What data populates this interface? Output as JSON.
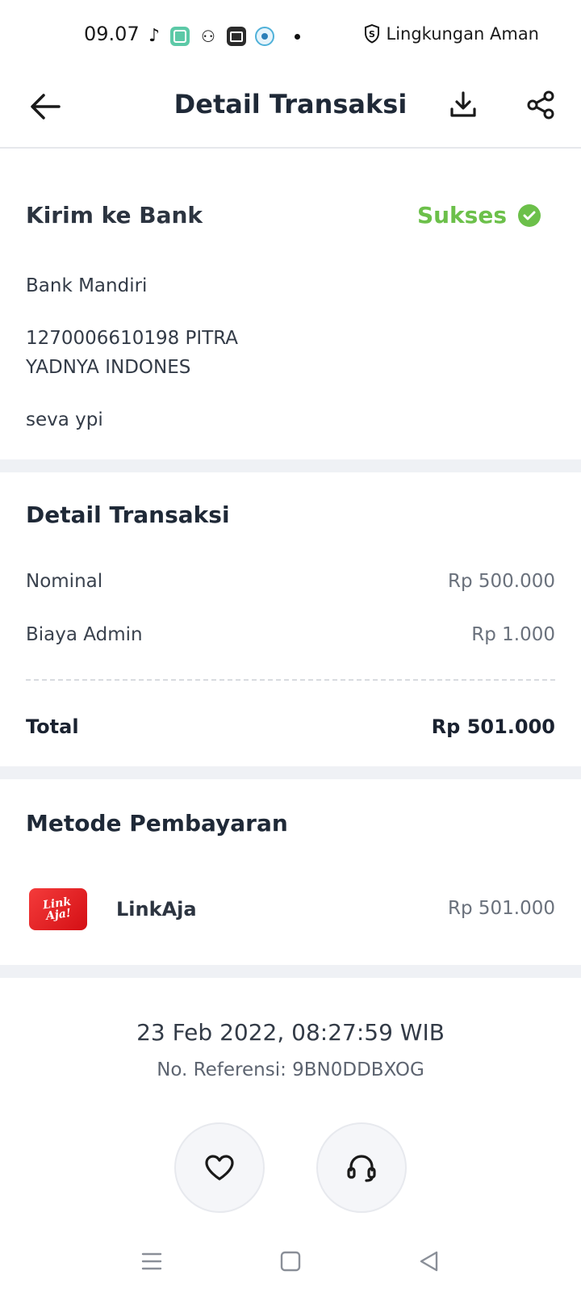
{
  "status_bar": {
    "time": "09.07",
    "notification_icons": [
      "music-note-icon",
      "teal-app-icon",
      "owl-icon",
      "dark-app-icon",
      "blue-app-icon"
    ],
    "right_label": "Lingkungan Aman"
  },
  "header": {
    "title": "Detail Transaksi"
  },
  "transfer": {
    "title": "Kirim ke Bank",
    "status": "Sukses",
    "bank_name": "Bank Mandiri",
    "account_line1": "1270006610198 PITRA",
    "account_line2": "YADNYA INDONES",
    "note": "seva ypi"
  },
  "details": {
    "title": "Detail Transaksi",
    "rows": [
      {
        "label": "Nominal",
        "value": "Rp 500.000"
      },
      {
        "label": "Biaya Admin",
        "value": "Rp 1.000"
      }
    ],
    "total_label": "Total",
    "total_value": "Rp 501.000"
  },
  "payment": {
    "title": "Metode Pembayaran",
    "logo_line1": "Link",
    "logo_line2": "Aja!",
    "method_name": "LinkAja",
    "amount": "Rp 501.000"
  },
  "footer": {
    "datetime": "23 Feb 2022, 08:27:59 WIB",
    "reference": "No. Referensi: 9BN0DDBXOG"
  },
  "colors": {
    "success": "#6cc04a",
    "brand_red": "#e3181d",
    "separator": "#eff1f5"
  }
}
